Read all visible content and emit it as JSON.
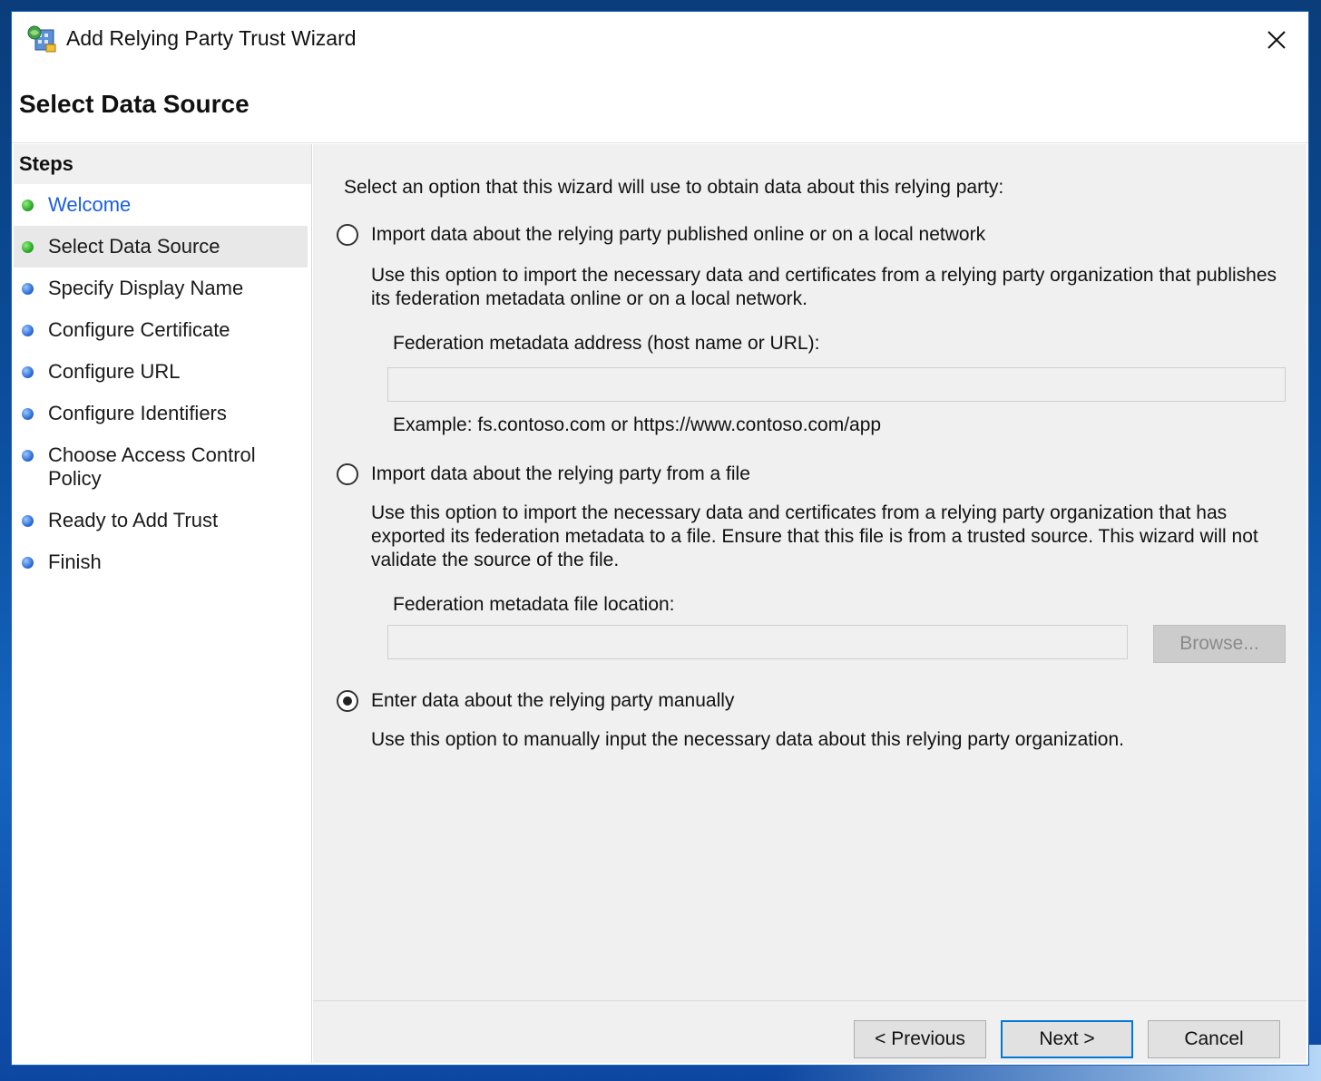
{
  "window": {
    "title": "Add Relying Party Trust Wizard",
    "close_glyph": "✕"
  },
  "page": {
    "title": "Select Data Source"
  },
  "steps": {
    "header": "Steps",
    "items": [
      {
        "label": "Welcome",
        "status": "done",
        "color": "#2da82a"
      },
      {
        "label": "Select Data Source",
        "status": "current",
        "color": "#2da82a"
      },
      {
        "label": "Specify Display Name",
        "status": "pending",
        "color": "#2f6fd6"
      },
      {
        "label": "Configure Certificate",
        "status": "pending",
        "color": "#2f6fd6"
      },
      {
        "label": "Configure URL",
        "status": "pending",
        "color": "#2f6fd6"
      },
      {
        "label": "Configure Identifiers",
        "status": "pending",
        "color": "#2f6fd6"
      },
      {
        "label": "Choose Access Control Policy",
        "label_line1": "Choose Access Control",
        "label_line2": "Policy",
        "status": "pending",
        "color": "#2f6fd6"
      },
      {
        "label": "Ready to Add Trust",
        "status": "pending",
        "color": "#2f6fd6"
      },
      {
        "label": "Finish",
        "status": "pending",
        "color": "#2f6fd6"
      }
    ]
  },
  "content": {
    "intro": "Select an option that this wizard will use to obtain data about this relying party:",
    "options": [
      {
        "label": "Import data about the relying party published online or on a local network",
        "selected": false,
        "description": "Use this option to import the necessary data and certificates from a relying party organization that publishes its federation metadata online or on a local network.",
        "field_label": "Federation metadata address (host name or URL):",
        "field_value": "",
        "example": "Example: fs.contoso.com or https://www.contoso.com/app"
      },
      {
        "label": "Import data about the relying party from a file",
        "selected": false,
        "description": "Use this option to import the necessary data and certificates from a relying party organization that has exported its federation metadata to a file. Ensure that this file is from a trusted source.  This wizard will not validate the source of the file.",
        "field_label": "Federation metadata file location:",
        "field_value": "",
        "browse_label": "Browse..."
      },
      {
        "label": "Enter data about the relying party manually",
        "selected": true,
        "description": "Use this option to manually input the necessary data about this relying party organization."
      }
    ]
  },
  "footer": {
    "previous_label": "< Previous",
    "next_label": "Next >",
    "cancel_label": "Cancel"
  },
  "colors": {
    "accent": "#0078d7",
    "link": "#1a5fe0",
    "step_done": "#2da82a",
    "step_pending": "#2f6fd6"
  },
  "icons": {
    "app": "relying-party-trust-icon",
    "close": "close-icon",
    "step_status": "status-dot-icon"
  }
}
